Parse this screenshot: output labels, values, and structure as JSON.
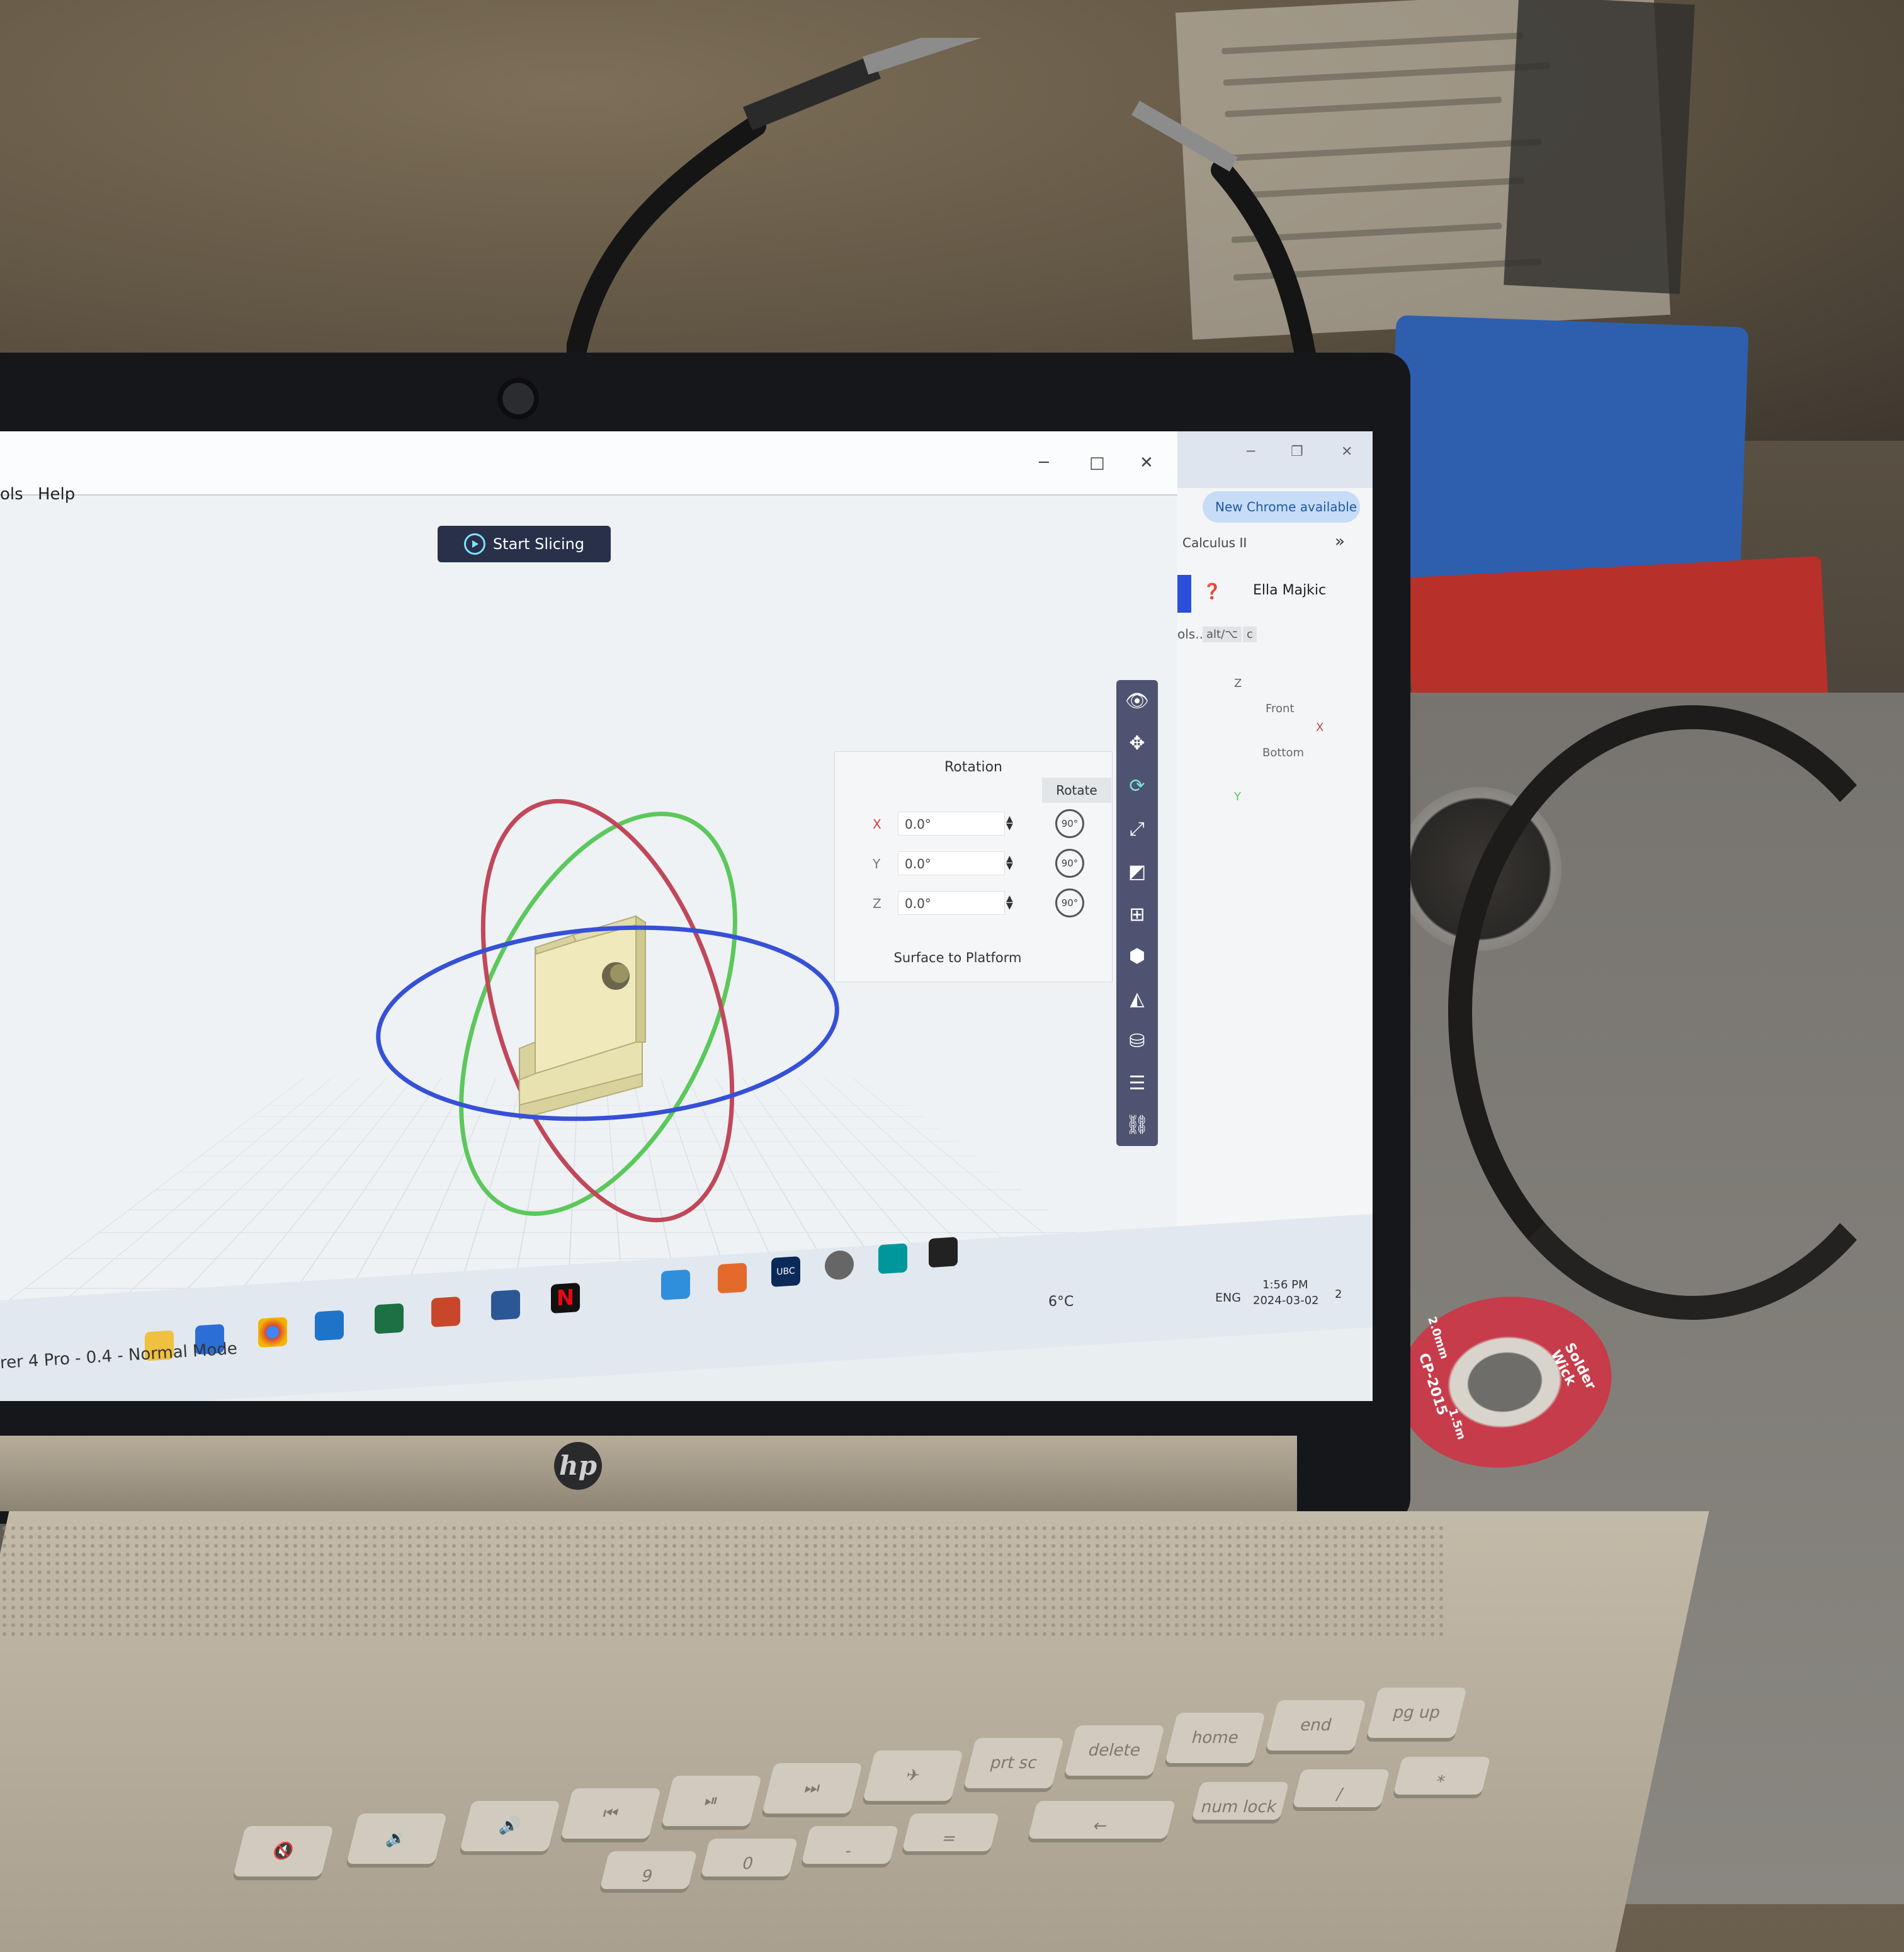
{
  "app": {
    "menu": [
      "ols",
      "Help"
    ],
    "window_controls": [
      "─",
      "□",
      "✕"
    ],
    "start_slicing_label": "Start Slicing",
    "status_text": "rer 4 Pro - 0.4 - Normal Mode"
  },
  "rotation_panel": {
    "title": "Rotation",
    "tooltip": "Rotate",
    "axes": [
      {
        "axis": "X",
        "value": "0.0°",
        "quick": "90°",
        "color": "#d63c3c"
      },
      {
        "axis": "Y",
        "value": "0.0°",
        "quick": "90°",
        "color": "#777777"
      },
      {
        "axis": "Z",
        "value": "0.0°",
        "quick": "90°",
        "color": "#777777"
      }
    ],
    "surface_button": "Surface to Platform"
  },
  "toolbar_icons": [
    "eye-icon",
    "move-icon",
    "rotate-icon",
    "scale-icon",
    "mirror-icon",
    "add-icon",
    "cube-icon",
    "support-icon",
    "cylinder-icon",
    "settings-icon",
    "link-icon"
  ],
  "chrome": {
    "update_badge": "New Chrome available",
    "tab_title": "Calculus II",
    "user_name": "Ella Majkic",
    "tools_text": "ols...",
    "shortcut": "alt/⌥",
    "shortcut_key": "c",
    "view_cube": {
      "z": "Z",
      "x": "X",
      "y": "Y",
      "front": "Front",
      "bottom": "Bottom"
    }
  },
  "taskbar": {
    "weather": "6°C",
    "language": "ENG",
    "time": "1:56 PM",
    "date": "2024-03-02",
    "notifications": "2",
    "ubc": "UBC"
  },
  "scene": {
    "spool_text": [
      "Solder Wick",
      "CP-2015",
      "2.0mm",
      "1.5m"
    ],
    "laptop_brand": "hp"
  },
  "colors": {
    "gizmo_x": "#c0485a",
    "gizmo_y": "#5cc85c",
    "gizmo_z": "#3650d6",
    "model": "#e8e2b0",
    "toolbar": "#4d5370",
    "slice_button": "#28304a"
  }
}
